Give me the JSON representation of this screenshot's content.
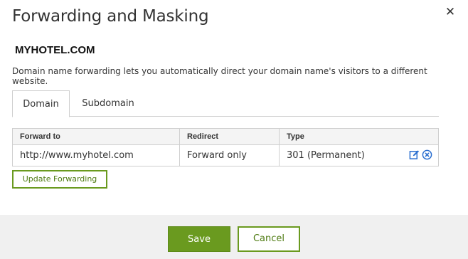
{
  "dialog": {
    "title": "Forwarding and Masking",
    "close_icon": "close-icon",
    "domain": "MYHOTEL.COM",
    "description": "Domain name forwarding lets you automatically direct your domain name's visitors to a different website."
  },
  "tabs": [
    {
      "label": "Domain",
      "active": true
    },
    {
      "label": "Subdomain",
      "active": false
    }
  ],
  "table": {
    "headers": [
      "Forward to",
      "Redirect",
      "Type"
    ],
    "rows": [
      {
        "forward_to": "http://www.myhotel.com",
        "redirect": "Forward only",
        "type": "301 (Permanent)",
        "actions": [
          "edit-icon",
          "remove-icon"
        ]
      }
    ]
  },
  "buttons": {
    "update": "Update Forwarding",
    "save": "Save",
    "cancel": "Cancel"
  },
  "colors": {
    "accent": "#6a9a1f",
    "icon_blue": "#2b6fd0"
  }
}
